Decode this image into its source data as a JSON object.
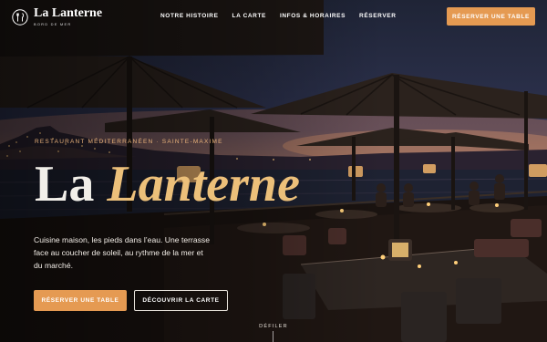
{
  "brand": {
    "name": "La Lanterne",
    "tagline": "BORD DE MER",
    "icon": "fork-knife-icon"
  },
  "nav": {
    "items": [
      {
        "label": "NOTRE HISTOIRE"
      },
      {
        "label": "LA CARTE"
      },
      {
        "label": "INFOS & HORAIRES"
      },
      {
        "label": "RÉSERVER"
      }
    ],
    "cta_label": "RÉSERVER UNE TABLE"
  },
  "hero": {
    "kicker": "RESTAURANT MÉDITERRANÉEN · SAINTE-MAXIME",
    "title_part1": "La ",
    "title_part2": "Lanterne",
    "description": "Cuisine maison, les pieds dans l’eau. Une terrasse face au coucher de soleil, au rythme de la mer et du marché.",
    "primary_button": "RÉSERVER UNE TABLE",
    "secondary_button": "DÉCOUVRIR LA CARTE",
    "scroll_label": "DÉFILER"
  },
  "colors": {
    "accent": "#e59a52",
    "title_italic": "#ecc07a",
    "kicker": "#e9b27a"
  }
}
